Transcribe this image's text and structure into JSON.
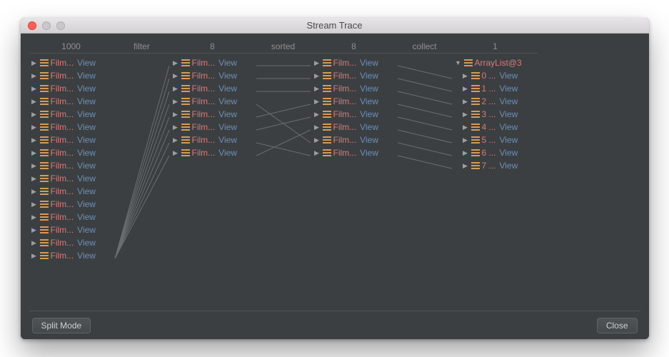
{
  "window": {
    "title": "Stream Trace"
  },
  "footer": {
    "split_mode_label": "Split Mode",
    "close_label": "Close"
  },
  "columns": [
    {
      "kind": "list",
      "header": "1000",
      "item_count": 16,
      "item_label": "Film...",
      "view_label": "View"
    },
    {
      "kind": "op",
      "header": "filter"
    },
    {
      "kind": "list",
      "header": "8",
      "item_count": 8,
      "item_label": "Film...",
      "view_label": "View"
    },
    {
      "kind": "op",
      "header": "sorted"
    },
    {
      "kind": "list",
      "header": "8",
      "item_count": 8,
      "item_label": "Film...",
      "view_label": "View"
    },
    {
      "kind": "op",
      "header": "collect"
    },
    {
      "kind": "list",
      "header": "1",
      "root": {
        "label": "ArrayList@3",
        "expanded": true
      },
      "children": [
        {
          "label": "0 ...",
          "view_label": "View"
        },
        {
          "label": "1 ...",
          "view_label": "View"
        },
        {
          "label": "2 ...",
          "view_label": "View"
        },
        {
          "label": "3 ...",
          "view_label": "View"
        },
        {
          "label": "4 ...",
          "view_label": "View"
        },
        {
          "label": "5 ...",
          "view_label": "View"
        },
        {
          "label": "6 ...",
          "view_label": "View"
        },
        {
          "label": "7 ...",
          "view_label": "View"
        }
      ]
    }
  ],
  "connectors": {
    "filter_to_col2": [
      {
        "from_index": 15,
        "to_index": 0
      },
      {
        "from_index": 15,
        "to_index": 1
      },
      {
        "from_index": 15,
        "to_index": 2
      },
      {
        "from_index": 15,
        "to_index": 3
      },
      {
        "from_index": 15,
        "to_index": 4
      },
      {
        "from_index": 15,
        "to_index": 5
      },
      {
        "from_index": 15,
        "to_index": 6
      },
      {
        "from_index": 15,
        "to_index": 7
      }
    ],
    "sorted": [
      {
        "from_index": 0,
        "to_index": 0
      },
      {
        "from_index": 1,
        "to_index": 1
      },
      {
        "from_index": 2,
        "to_index": 2
      },
      {
        "from_index": 3,
        "to_index": 6
      },
      {
        "from_index": 4,
        "to_index": 3
      },
      {
        "from_index": 5,
        "to_index": 4
      },
      {
        "from_index": 6,
        "to_index": 7
      },
      {
        "from_index": 7,
        "to_index": 5
      }
    ],
    "collect": [
      {
        "from_index": 0,
        "to_index": 1
      },
      {
        "from_index": 1,
        "to_index": 2
      },
      {
        "from_index": 2,
        "to_index": 3
      },
      {
        "from_index": 3,
        "to_index": 4
      },
      {
        "from_index": 4,
        "to_index": 5
      },
      {
        "from_index": 5,
        "to_index": 6
      },
      {
        "from_index": 6,
        "to_index": 7
      },
      {
        "from_index": 7,
        "to_index": 8
      }
    ]
  }
}
